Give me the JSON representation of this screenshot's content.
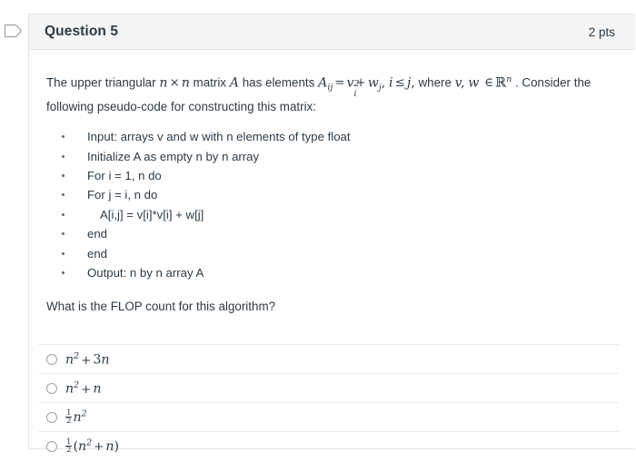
{
  "gutter": {
    "icon": "flag-outline-icon"
  },
  "header": {
    "title": "Question 5",
    "points": "2 pts"
  },
  "question": {
    "intro_part1": "The upper triangular ",
    "intro_n": "n",
    "intro_times": "×",
    "intro_n2": "n",
    "intro_matrix_word": " matrix ",
    "intro_A": "A",
    "intro_part2": " has elements ",
    "elem_A": "A",
    "elem_A_sub": "ij",
    "elem_eq": "=",
    "elem_v": "v",
    "elem_v_sub": "i",
    "elem_v_sup": "2",
    "elem_plus": "+",
    "elem_w": "w",
    "elem_w_sub": "j",
    "elem_comma": ",",
    "cond_i": "i",
    "cond_le": "≤",
    "cond_j": "j",
    "cond_period": ",",
    "where_word": " where ",
    "where_v": "v,",
    "where_w": "w",
    "where_in": "∈",
    "where_R": "ℝ",
    "where_R_sup": "n",
    "tail": " . Consider the following pseudo-code for constructing this matrix:",
    "line2": "following pseudo-code for constructing this matrix:",
    "code_lines": [
      {
        "indent": 0,
        "text": "Input: arrays v and w with n elements of type float"
      },
      {
        "indent": 0,
        "text": "Initialize A as empty n by n array"
      },
      {
        "indent": 0,
        "text": "For i = 1, n do"
      },
      {
        "indent": 1,
        "text": "For j = i, n do"
      },
      {
        "indent": 2,
        "text": "A[i,j] = v[i]*v[i] + w[j]"
      },
      {
        "indent": 1,
        "text": "end"
      },
      {
        "indent": 0,
        "text": "end"
      },
      {
        "indent": 0,
        "text": "Output: n by n array A"
      }
    ],
    "prompt": "What is the FLOP count for this algorithm?"
  },
  "answers": [
    {
      "id": "option-a",
      "label": "n² + 3n",
      "parts": [
        {
          "kind": "var",
          "text": "n"
        },
        {
          "kind": "sup",
          "text": "2"
        },
        {
          "kind": "op",
          "text": "+"
        },
        {
          "kind": "num",
          "text": "3"
        },
        {
          "kind": "var",
          "text": "n"
        }
      ],
      "selected": false
    },
    {
      "id": "option-b",
      "label": "n² + n",
      "parts": [
        {
          "kind": "var",
          "text": "n"
        },
        {
          "kind": "sup",
          "text": "2"
        },
        {
          "kind": "op",
          "text": "+"
        },
        {
          "kind": "var",
          "text": "n"
        }
      ],
      "selected": false
    },
    {
      "id": "option-c",
      "label": "½n²",
      "parts": [
        {
          "kind": "frac",
          "num": "1",
          "den": "2"
        },
        {
          "kind": "var",
          "text": "n"
        },
        {
          "kind": "sup",
          "text": "2"
        }
      ],
      "selected": false
    },
    {
      "id": "option-d",
      "label": "½(n² + n)",
      "parts": [
        {
          "kind": "frac",
          "num": "1",
          "den": "2"
        },
        {
          "kind": "num",
          "text": "("
        },
        {
          "kind": "var",
          "text": "n"
        },
        {
          "kind": "sup",
          "text": "2"
        },
        {
          "kind": "op",
          "text": "+"
        },
        {
          "kind": "var",
          "text": "n"
        },
        {
          "kind": "num",
          "text": ")"
        }
      ],
      "selected": false
    }
  ],
  "colors": {
    "text": "#2d3b45",
    "header_bg": "#f5f5f5",
    "border": "#e3e5e7",
    "divider": "#ececee",
    "radio_border": "#9ba3a9"
  }
}
